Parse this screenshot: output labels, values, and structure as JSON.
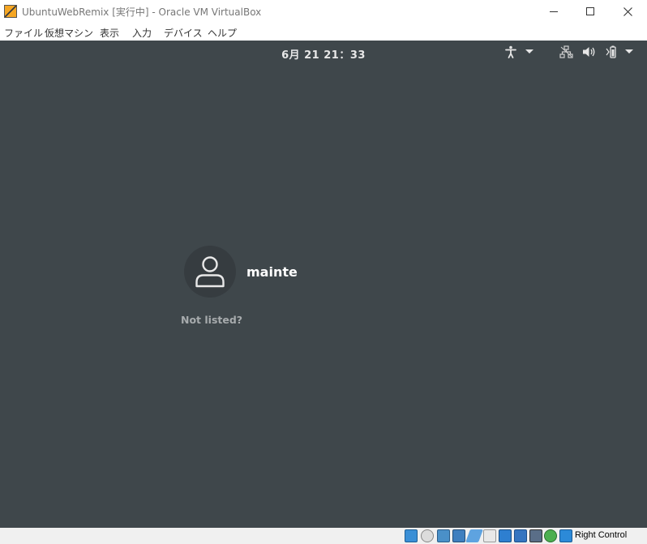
{
  "window": {
    "title": "UbuntuWebRemix [実行中] - Oracle VM VirtualBox",
    "minimize_glyph": "minimize-icon",
    "maximize_glyph": "maximize-icon",
    "close_glyph": "close-icon"
  },
  "menubar": {
    "items": [
      "ファイル",
      "仮想マシン",
      "表示",
      "入力",
      "デバイス",
      "ヘルプ"
    ]
  },
  "gnome": {
    "clock": "6月 21  21：33",
    "tray": [
      "accessibility-icon",
      "accessibility-menu-arrow-icon",
      "network-icon",
      "volume-icon",
      "battery-icon",
      "system-menu-arrow-icon"
    ]
  },
  "login": {
    "username": "mainte",
    "not_listed": "Not listed?"
  },
  "statusbar": {
    "icons": [
      "hard-disk-icon",
      "optical-drive-icon",
      "audio-icon",
      "network-adapter-icon",
      "usb-icon",
      "shared-folders-icon",
      "display-icon",
      "video-capture-icon",
      "cpu-icon",
      "mouse-integration-icon",
      "keyboard-capture-icon"
    ],
    "host_key": "Right Control"
  },
  "colors": {
    "desktop_bg": "#3f474b",
    "avatar_bg": "#363c40",
    "statusbar_bg": "#f0f0f0"
  }
}
